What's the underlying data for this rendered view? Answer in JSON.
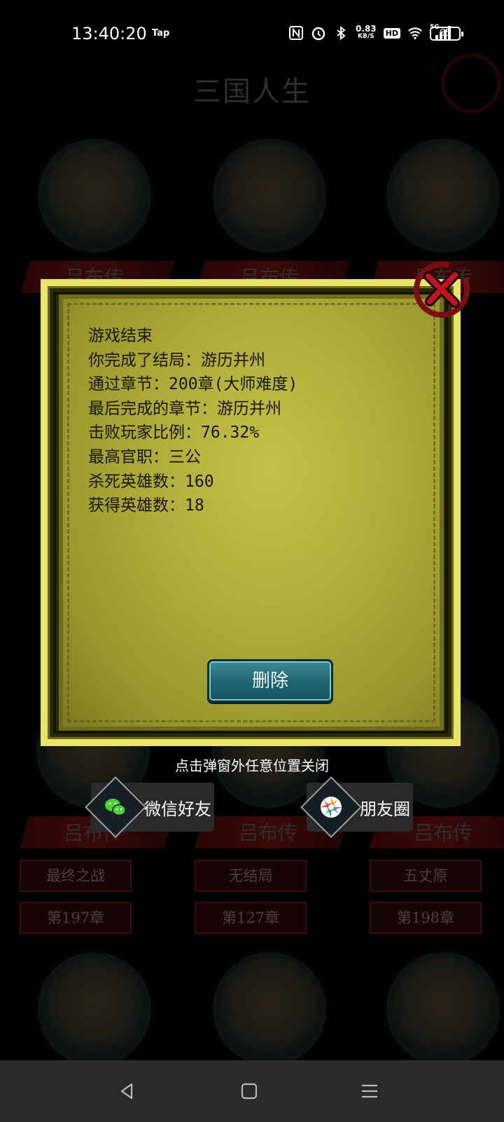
{
  "status_bar": {
    "time": "13:40:20",
    "app_tag": "Tap",
    "net_speed_value": "0.83",
    "net_speed_unit": "KB/S",
    "hd": "HD",
    "signal": "5G",
    "battery": "65"
  },
  "background": {
    "title": "三国人生",
    "cards": [
      {
        "name": "吕布传",
        "ending": "",
        "chapter": ""
      },
      {
        "name": "吕布传",
        "ending": "",
        "chapter": ""
      },
      {
        "name": "吕布传",
        "ending": "",
        "chapter": ""
      },
      {
        "name": "吕布传",
        "ending": "最终之战",
        "chapter": "第197章"
      },
      {
        "name": "吕布传",
        "ending": "无结局",
        "chapter": "第127章"
      },
      {
        "name": "吕布传",
        "ending": "五丈原",
        "chapter": "第198章"
      }
    ]
  },
  "modal": {
    "lines": [
      "游戏结束",
      "你完成了结局：游历并州",
      "通过章节：200章(大师难度)",
      "最后完成的章节：游历并州",
      "击败玩家比例：76.32%",
      "最高官职：三公",
      "杀死英雄数：160",
      "获得英雄数：18"
    ],
    "delete_label": "删除",
    "dismiss_hint": "点击弹窗外任意位置关闭"
  },
  "share": {
    "wechat_label": "微信好友",
    "moments_label": "朋友圈"
  },
  "colors": {
    "frame": "#e9e56a",
    "parchment": "#b0ad3a",
    "button": "#1f6470"
  }
}
